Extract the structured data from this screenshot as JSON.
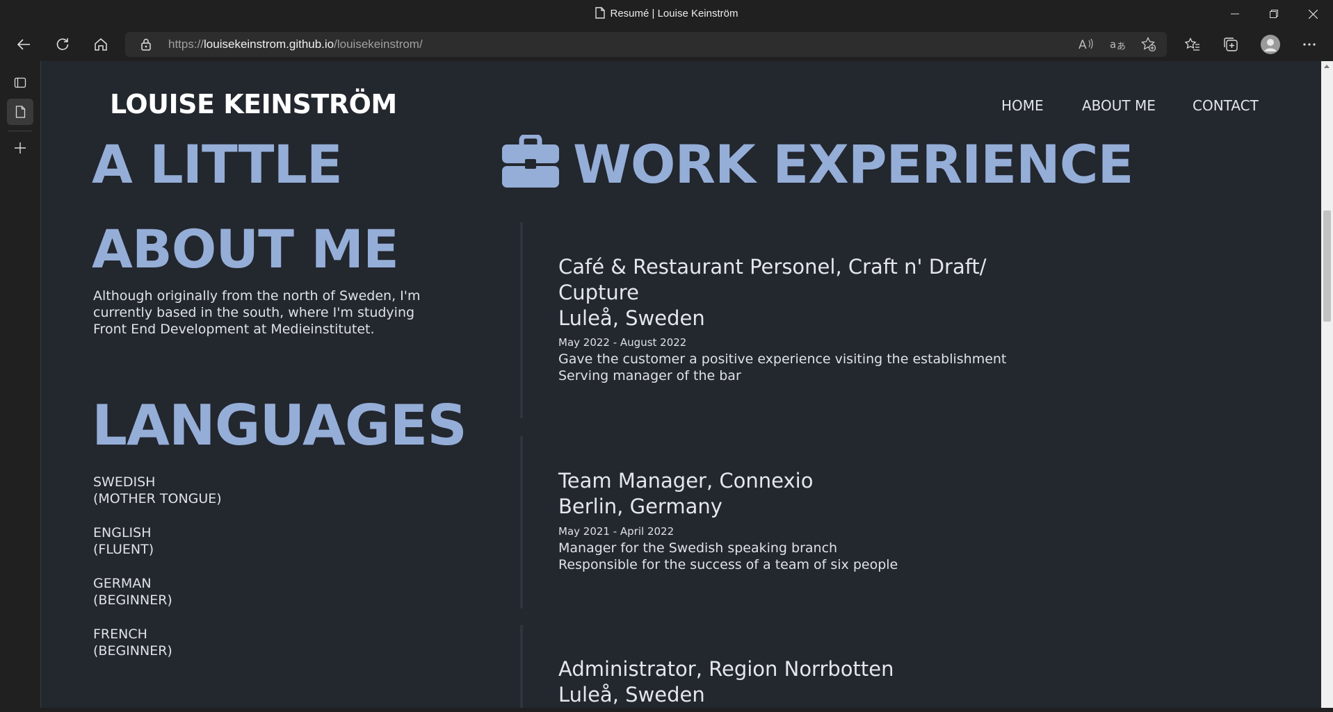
{
  "browser": {
    "tab_title": "Resumé | Louise Keinström",
    "url_scheme": "https://",
    "url_host": "louisekeinstrom.github.io",
    "url_path": "/louisekeinstrom/"
  },
  "site": {
    "logo": "LOUISE KEINSTRÖM",
    "nav": [
      "HOME",
      "ABOUT ME",
      "CONTACT"
    ]
  },
  "about": {
    "heading_line1": "A LITTLE",
    "heading_line2": "ABOUT ME",
    "text": "Although originally from the north of Sweden, I'm currently based in the south, where I'm studying Front End Development at Medieinstitutet."
  },
  "languages": {
    "heading": "LANGUAGES",
    "items": [
      {
        "name": "SWEDISH",
        "level": "(MOTHER TONGUE)"
      },
      {
        "name": "ENGLISH",
        "level": "(FLUENT)"
      },
      {
        "name": "GERMAN",
        "level": "(BEGINNER)"
      },
      {
        "name": "FRENCH",
        "level": "(BEGINNER)"
      }
    ]
  },
  "work": {
    "heading": "WORK EXPERIENCE",
    "icon": "briefcase-icon",
    "jobs": [
      {
        "title": "Café & Restaurant Personel, Craft n' Draft/ Cupture",
        "location": "Luleå, Sweden",
        "dates": "May 2022 - August 2022",
        "duties": [
          "Gave the customer a positive experience visiting the establishment",
          "Serving manager of the bar"
        ]
      },
      {
        "title": "Team Manager, Connexio",
        "location": "Berlin, Germany",
        "dates": "May 2021 - April 2022",
        "duties": [
          "Manager for the Swedish speaking branch",
          "Responsible for the success of a team of six people"
        ]
      },
      {
        "title": "Administrator, Region Norrbotten",
        "location": "Luleå, Sweden"
      }
    ]
  },
  "colors": {
    "page_bg": "#23272e",
    "heading_accent": "#95aed8",
    "chrome_bg": "#202020"
  }
}
